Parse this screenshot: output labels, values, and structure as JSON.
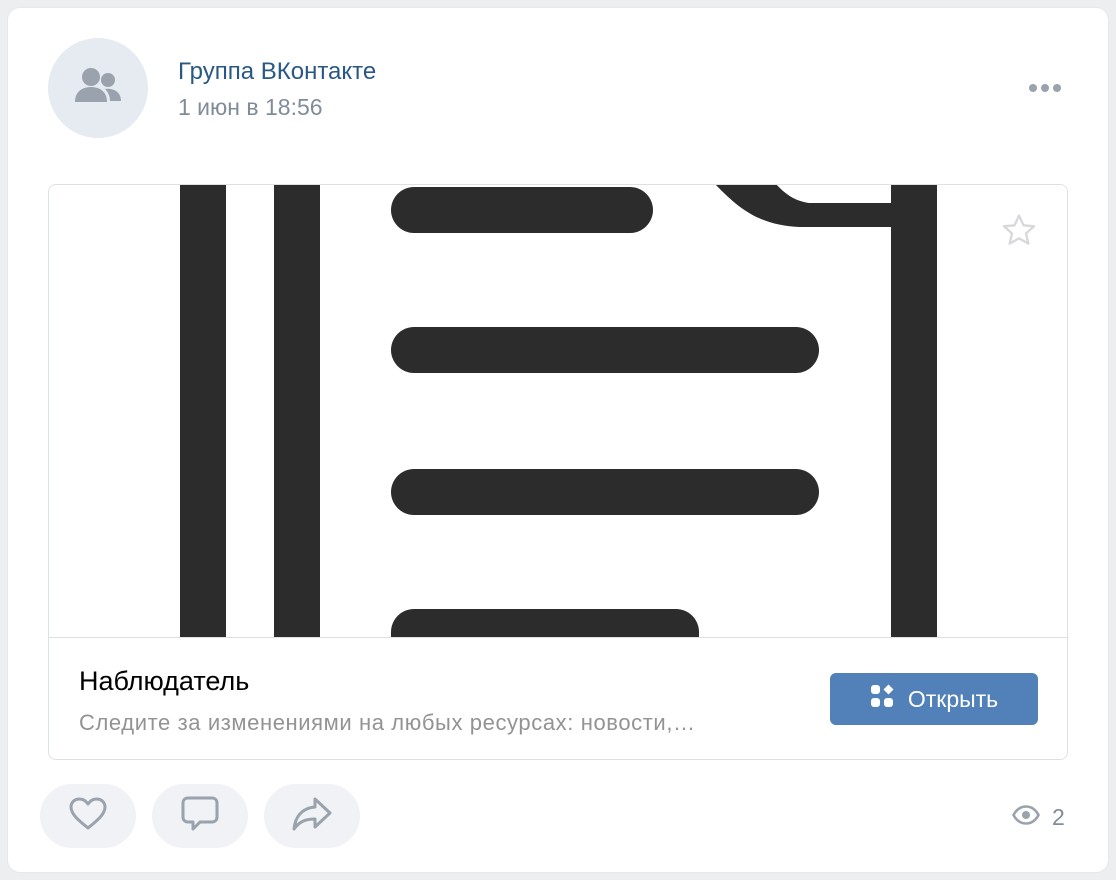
{
  "post": {
    "author": "Группа ВКонтакте",
    "date": "1 июн в 18:56",
    "avatar_icon": "users-icon",
    "more_icon": "more-horizontal-icon"
  },
  "card": {
    "title": "Наблюдатель",
    "description": "Следите за изменениями на любых ресурсах: новости,…",
    "open_label": "Открыть",
    "open_icon": "services-icon",
    "favorite_icon": "star-icon",
    "image_icon": "document-lines-icon"
  },
  "actions": {
    "like_icon": "heart-icon",
    "comment_icon": "comment-icon",
    "share_icon": "share-icon"
  },
  "views": {
    "icon": "eye-icon",
    "count": "2"
  },
  "colors": {
    "link": "#2a5885",
    "accent_button": "#5181b8",
    "muted_text": "#818c99",
    "icon": "#99a2ad"
  }
}
